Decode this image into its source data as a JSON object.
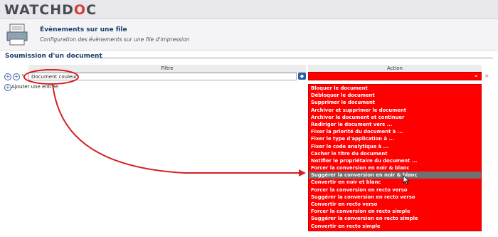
{
  "app": {
    "logo_prefix": "WATCHD",
    "logo_mid": "O",
    "logo_suffix": "C"
  },
  "header": {
    "title": "Évènements sur une file",
    "subtitle": "Configuration des évènements sur une file d'impression"
  },
  "section": {
    "title": "Soumission d'un document"
  },
  "columns": {
    "filter": "Filtre",
    "action": "Action"
  },
  "row": {
    "filter_value": "Document couleur"
  },
  "add_filter_label": "Ajouter une entrée",
  "icons": {
    "plus": "plus-icon",
    "tag": "tag-icon",
    "remove": "close-icon",
    "chevron": "chevron-down-icon"
  },
  "colors": {
    "accent_red": "#ff0000",
    "selected_grey": "#707070",
    "annotation_red": "#d42020"
  },
  "dropdown": {
    "options": [
      "Bloquer le document",
      "Débloquer le document",
      "Supprimer le document",
      "Archiver et supprimer le document",
      "Archiver le document et continuer",
      "Rediriger le document vers ...",
      "Fixer la priorité du document à ...",
      "Fixer le type d'application à ...",
      "Fixer le code analytique à ...",
      "Cacher le titre du document",
      "Notifier le propriétaire du document ...",
      "Forcer la conversion en noir & blanc",
      "Suggérer la conversion en noir & blanc",
      "Convertir en noir et blanc",
      "Forcer la conversion en recto verso",
      "Suggérer la conversion en recto verso",
      "Convertir en recto verso",
      "Forcer la conversion en recto simple",
      "Suggérer la conversion en recto simple",
      "Convertir en recto simple"
    ],
    "selected_index": 12
  }
}
